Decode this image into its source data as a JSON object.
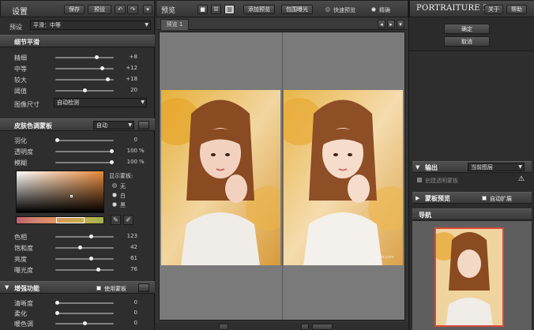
{
  "left": {
    "title": "设置",
    "save_label": "保存",
    "preset_btn_label": "预设",
    "undo_icon": "undo-icon",
    "redo_icon": "redo-icon",
    "preset_label": "预设",
    "preset_value": "平滑：中等",
    "detail_smooth": {
      "title": "细节平滑",
      "rows": [
        {
          "label": "精细",
          "value": "+8",
          "level": 0.72
        },
        {
          "label": "中等",
          "value": "+12",
          "level": 0.82
        },
        {
          "label": "较大",
          "value": "+18",
          "level": 0.93
        },
        {
          "label": "阈值",
          "value": "20",
          "level": 0.5
        }
      ],
      "image_size_label": "图像尺寸",
      "image_size_value": "自动检测"
    },
    "skin_mask": {
      "title": "皮肤色调蒙板",
      "mode_value": "自动",
      "rows": [
        {
          "label": "羽化",
          "value": "0",
          "level": 0.0,
          "unit": ""
        },
        {
          "label": "透明度",
          "value": "100",
          "level": 1.0,
          "unit": "%"
        },
        {
          "label": "模糊",
          "value": "100",
          "level": 1.0,
          "unit": "%"
        }
      ],
      "show_mask_label": "显示蒙板:",
      "radios": [
        {
          "label": "无",
          "selected": true
        },
        {
          "label": "白",
          "selected": false
        },
        {
          "label": "黑",
          "selected": false
        }
      ],
      "hue_rows": [
        {
          "label": "色相",
          "value": "123",
          "level": 0.62
        },
        {
          "label": "饱和度",
          "value": "42",
          "level": 0.42
        },
        {
          "label": "亮度",
          "value": "61",
          "level": 0.62
        },
        {
          "label": "曝光度",
          "value": "76",
          "level": 0.76
        }
      ]
    },
    "enhance": {
      "title": "增强功能",
      "use_mask_label": "使用蒙板",
      "rows": [
        {
          "label": "清晰度",
          "value": "0",
          "level": 0.0
        },
        {
          "label": "柔化",
          "value": "0",
          "level": 0.0
        },
        {
          "label": "暖色调",
          "value": "0",
          "level": 0.5
        }
      ]
    }
  },
  "center": {
    "title": "预览",
    "add_preview_label": "添加预览",
    "exposure_label": "包围曝光",
    "quick_preview_label": "快速预览",
    "precise_label": "精确",
    "tab_label": "预览 1",
    "overlay_text": "tyuio.com"
  },
  "right": {
    "brand": "PORTRAITURE 2",
    "about_label": "关于",
    "help_label": "帮助",
    "ok_label": "确定",
    "cancel_label": "取消",
    "output_label": "输出",
    "output_value": "当前图层",
    "new_mask_layer_label": "创建透明蒙板",
    "mask_preview_label": "蒙板预览",
    "auto_expand_label": "自动扩展",
    "nav_label": "导航"
  },
  "colors": {
    "accent_red": "#d94a3a",
    "panel_bg": "#2b2b2b",
    "mask_orange": "#e98a3a"
  }
}
